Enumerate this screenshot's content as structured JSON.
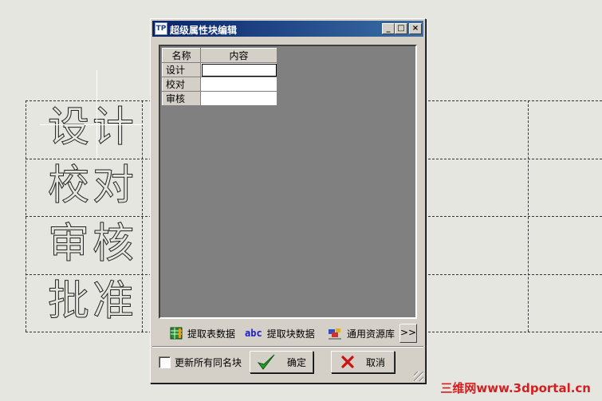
{
  "drawing": {
    "cells": [
      "设计",
      "校对",
      "审核",
      "批准"
    ]
  },
  "dialog": {
    "title": "超级属性块编辑",
    "window_buttons": {
      "minimize": "_",
      "maximize": "□",
      "close": "×"
    },
    "table": {
      "headers": [
        "名称",
        "内容"
      ],
      "rows": [
        {
          "name": "设计",
          "value": ""
        },
        {
          "name": "校对",
          "value": ""
        },
        {
          "name": "审核",
          "value": ""
        }
      ]
    },
    "toolbar": {
      "extract_table": "提取表数据",
      "abc_label": "abc",
      "extract_block": "提取块数据",
      "resource_lib": "通用资源库",
      "more": ">>"
    },
    "update_all_label": "更新所有同名块",
    "ok_label": "确定",
    "cancel_label": "取消"
  },
  "watermark": "三维网www.3dportal.cn",
  "colors": {
    "title_start": "#0a246a",
    "title_end": "#3a6ea5",
    "ok_check": "#2a9a2a",
    "cancel_x": "#cc1111"
  }
}
